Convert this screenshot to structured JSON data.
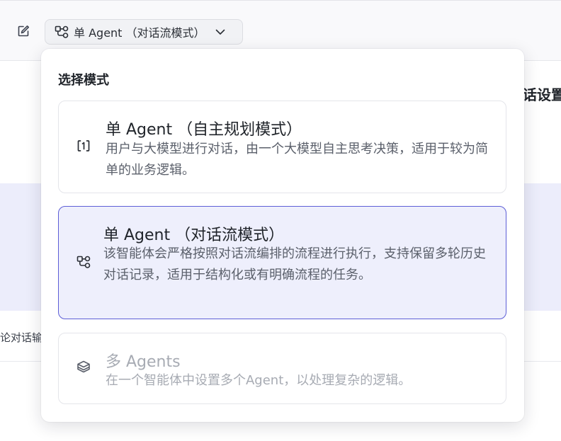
{
  "toolbar": {
    "mode_label": "单 Agent （对话流模式）"
  },
  "background": {
    "right_label": "话设置",
    "left_text": "论对话输"
  },
  "popover": {
    "title": "选择模式",
    "options": [
      {
        "title": "单 Agent （自主规划模式）",
        "description": "用户与大模型进行对话，由一个大模型自主思考决策，适用于较为简单的业务逻辑。",
        "icon": "single-agent-icon",
        "state": "default"
      },
      {
        "title": "单 Agent （对话流模式）",
        "description": "该智能体会严格按照对话流编排的流程进行执行，支持保留多轮历史对话记录，适用于结构化或有明确流程的任务。",
        "icon": "workflow-icon",
        "state": "selected"
      },
      {
        "title": "多 Agents",
        "description": "在一个智能体中设置多个Agent，以处理复杂的逻辑。",
        "icon": "layers-icon",
        "state": "disabled"
      }
    ]
  },
  "colors": {
    "accent": "#5d5ed6",
    "selected_bg": "#eeeffc",
    "disabled_text": "#a7abb3"
  }
}
